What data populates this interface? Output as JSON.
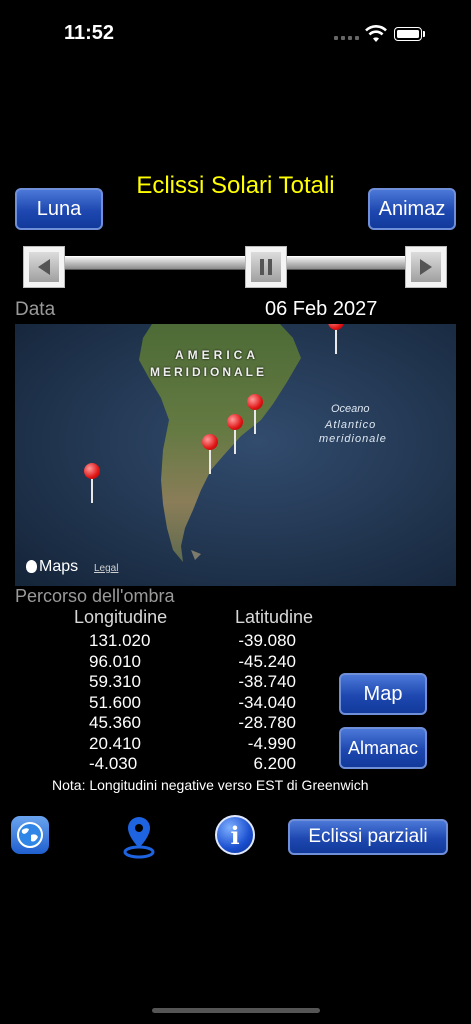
{
  "status": {
    "time": "11:52"
  },
  "header": {
    "title": "Eclissi Solari Totali",
    "left_button": "Luna",
    "right_button": "Animaz"
  },
  "date_row": {
    "label": "Data",
    "value": "06 Feb 2027"
  },
  "map": {
    "continent_label_1": "AMERICA",
    "continent_label_2": "MERIDIONALE",
    "ocean_label_1": "Oceano",
    "ocean_label_2": "Atlantico",
    "ocean_label_3": "meridionale",
    "brand": "Maps",
    "legal": "Legal"
  },
  "path": {
    "title": "Percorso dell'ombra",
    "longitude_header": "Longitudine",
    "latitude_header": "Latitudine",
    "longitudes": [
      "131.020",
      "96.010",
      "59.310",
      "51.600",
      "45.360",
      "20.410",
      "-4.030"
    ],
    "latitudes": [
      "-39.080",
      "-45.240",
      "-38.740",
      "-34.040",
      "-28.780",
      "-4.990",
      "6.200"
    ],
    "note": "Nota: Longitudini negative verso EST di Greenwich"
  },
  "side_buttons": {
    "map": "Map",
    "almanac": "Almanac"
  },
  "bottom": {
    "partial_button": "Eclissi parziali"
  },
  "colors": {
    "title": "#ffff00",
    "button": "#1e48b0",
    "pin": "#e01515"
  }
}
